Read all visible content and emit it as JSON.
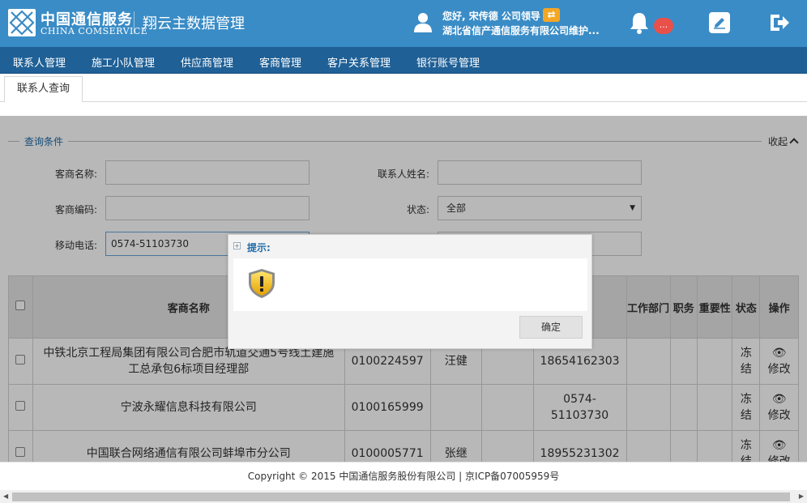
{
  "header": {
    "logo_cn": "中国通信服务",
    "logo_en": "CHINA COMSERVICE",
    "app_title": "翔云主数据管理",
    "greeting": "您好, 宋传德 公司领导",
    "organization": "湖北省信产通信服务有限公司维护...",
    "notification_badge": "...",
    "brand_color": "#3a8cc6"
  },
  "nav": {
    "items": [
      "联系人管理",
      "施工小队管理",
      "供应商管理",
      "客商管理",
      "客户关系管理",
      "银行账号管理"
    ]
  },
  "tabs": {
    "active": "联系人查询"
  },
  "query": {
    "section_title": "查询条件",
    "collapse_label": "收起",
    "merchant_name_label": "客商名称:",
    "merchant_name_value": "",
    "contact_name_label": "联系人姓名:",
    "contact_name_value": "",
    "merchant_code_label": "客商编码:",
    "merchant_code_value": "",
    "status_label": "状态:",
    "status_value": "全部",
    "mobile_label": "移动电话:",
    "mobile_value": "0574-51103730"
  },
  "table": {
    "headers": {
      "merchant_name": "客商名称",
      "phone": "话",
      "dept": "工作部门",
      "position": "职务",
      "important": "重要性",
      "status": "状态",
      "action": "操作"
    },
    "rows": [
      {
        "name": "中铁北京工程局集团有限公司合肥市轨道交通5号线土建施工总承包6标项目经理部",
        "code": "0100224597",
        "contact": "汪健",
        "mobile": "18654162303",
        "status": "冻结",
        "action": "修改"
      },
      {
        "name": "宁波永耀信息科技有限公司",
        "code": "0100165999",
        "contact": "",
        "mobile": "0574-51103730",
        "status": "冻结",
        "action": "修改"
      },
      {
        "name": "中国联合网络通信有限公司蚌埠市分公司",
        "code": "0100005771",
        "contact": "张继",
        "mobile": "18955231302",
        "status": "冻结",
        "action": "修改"
      }
    ]
  },
  "dialog": {
    "title": "提示:",
    "ok_label": "确定"
  },
  "footer": {
    "copyright": "Copyright © 2015 中国通信服务股份有限公司 | 京ICP备07005959号"
  }
}
